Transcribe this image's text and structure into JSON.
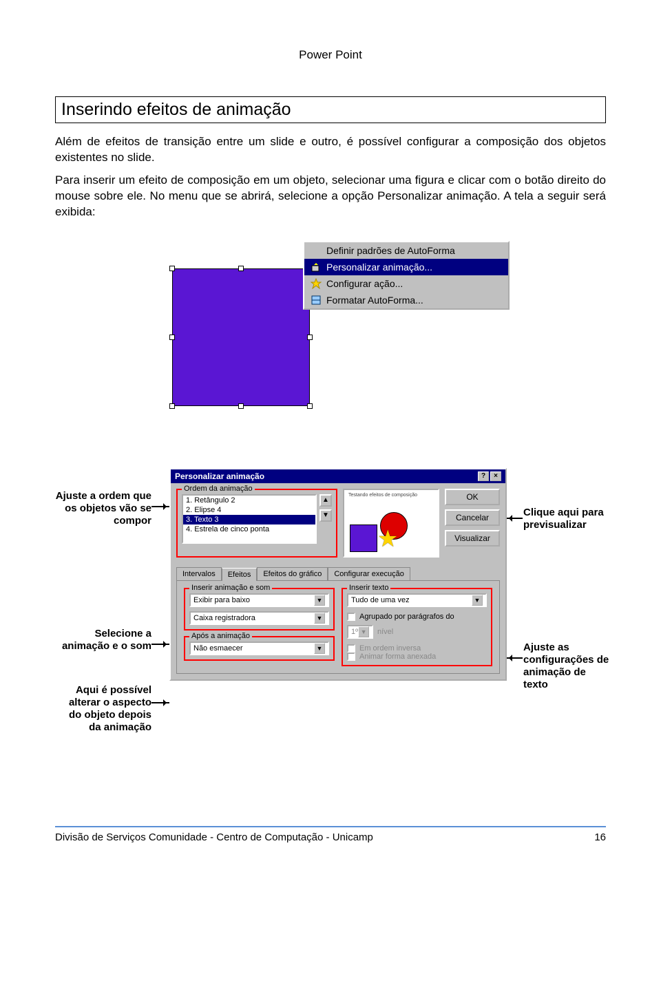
{
  "header": {
    "title": "Power Point"
  },
  "section": {
    "title": "Inserindo efeitos de animação"
  },
  "paragraphs": {
    "p1": "Além de efeitos de transição entre um slide e outro, é possível configurar a composição dos objetos existentes no slide.",
    "p2": "Para inserir um efeito de composição em um objeto, selecionar uma figura e clicar com o botão direito do mouse sobre ele. No menu que se abrirá, selecione a opção Personalizar animação. A tela a seguir será exibida:"
  },
  "context_menu": {
    "items": [
      "Definir padrões de AutoForma",
      "Personalizar animação...",
      "Configurar ação...",
      "Formatar AutoForma..."
    ],
    "selected_index": 1
  },
  "annotations": {
    "left1": "Ajuste a ordem que os objetos vão se compor",
    "left2": "Selecione a animação e o som",
    "left3": "Aqui é possível alterar o aspecto do objeto depois da animação",
    "right1": "Clique aqui para previsualizar",
    "right2": "Ajuste as configurações de animação de texto"
  },
  "dialog": {
    "title": "Personalizar animação",
    "order_legend": "Ordem da animação",
    "order_items": [
      "1. Retângulo 2",
      "2. Elipse 4",
      "3. Texto 3",
      "4. Estrela de cinco ponta"
    ],
    "order_selected_index": 2,
    "preview_text": "Testando efeitos de composição",
    "buttons": {
      "ok": "OK",
      "cancel": "Cancelar",
      "preview": "Visualizar"
    },
    "tabs": [
      "Intervalos",
      "Efeitos",
      "Efeitos do gráfico",
      "Configurar execução"
    ],
    "active_tab_index": 1,
    "effects": {
      "insert_anim_legend": "Inserir animação e som",
      "anim_value": "Exibir para baixo",
      "sound_value": "Caixa registradora",
      "after_legend": "Após a animação",
      "after_value": "Não esmaecer",
      "insert_text_legend": "Inserir texto",
      "text_value": "Tudo de uma vez",
      "group_chk": "Agrupado por parágrafos do",
      "level_value": "1º",
      "level_label": "nível",
      "reverse_chk": "Em ordem inversa",
      "attach_chk": "Animar forma anexada"
    }
  },
  "footer": {
    "text": "Divisão de Serviços Comunidade - Centro de Computação - Unicamp",
    "page": "16"
  }
}
